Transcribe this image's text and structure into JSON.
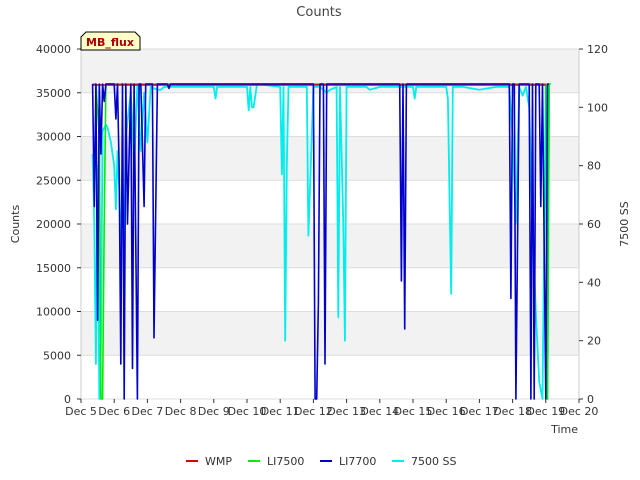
{
  "chart_data": {
    "type": "line",
    "title": "Counts",
    "xlabel": "Time",
    "ylabel": "Counts",
    "y2label": "7500 SS",
    "site_label": "MB_flux",
    "x_ticks": [
      "Dec 5",
      "Dec 6",
      "Dec 7",
      "Dec 8",
      "Dec 9",
      "Dec 10",
      "Dec 11",
      "Dec 12",
      "Dec 13",
      "Dec 14",
      "Dec 15",
      "Dec 16",
      "Dec 17",
      "Dec 18",
      "Dec 19",
      "Dec 20"
    ],
    "xlim": [
      5,
      20
    ],
    "ylim": [
      0,
      40000
    ],
    "y_ticks": [
      "0",
      "5000",
      "10000",
      "15000",
      "20000",
      "25000",
      "30000",
      "35000",
      "40000"
    ],
    "y2lim": [
      0,
      120
    ],
    "y2_ticks": [
      "0",
      "20",
      "40",
      "60",
      "80",
      "100",
      "120"
    ],
    "grid": true,
    "legend_position": "bottom",
    "legend": [
      {
        "name": "WMP",
        "color": "#dd0000"
      },
      {
        "name": "LI7500",
        "color": "#00ee00"
      },
      {
        "name": "LI7700",
        "color": "#0000cc"
      },
      {
        "name": "7500 SS",
        "color": "#00eeee"
      }
    ],
    "series": [
      {
        "name": "WMP",
        "color": "#dd0000",
        "axis": "left",
        "x": [
          5.35,
          19.0
        ],
        "y": [
          35900,
          35900
        ]
      },
      {
        "name": "LI7500",
        "color": "#00ee00",
        "axis": "left",
        "x": [
          5.35,
          5.45,
          5.55,
          5.6,
          5.65,
          5.7,
          5.75,
          5.85,
          6.0,
          19.0,
          19.05,
          19.1,
          19.15
        ],
        "y": [
          36000,
          36000,
          30000,
          0,
          0,
          20000,
          36000,
          36000,
          36000,
          36000,
          0,
          36000,
          36000
        ]
      },
      {
        "name": "LI7700",
        "color": "#0000cc",
        "axis": "left",
        "x": [
          5.35,
          5.4,
          5.45,
          5.5,
          5.55,
          5.6,
          5.65,
          5.7,
          5.75,
          5.8,
          5.9,
          6.0,
          6.05,
          6.1,
          6.15,
          6.2,
          6.25,
          6.3,
          6.35,
          6.4,
          6.5,
          6.55,
          6.6,
          6.7,
          6.75,
          6.8,
          6.9,
          6.95,
          7.0,
          7.1,
          7.15,
          7.2,
          7.3,
          7.6,
          7.65,
          7.7,
          7.75,
          9.0,
          9.05,
          12.0,
          12.05,
          12.1,
          12.15,
          12.2,
          12.3,
          12.35,
          12.4,
          12.5,
          13.0,
          13.05,
          13.1,
          14.6,
          14.65,
          14.7,
          14.75,
          14.8,
          14.85,
          14.9,
          17.9,
          17.95,
          18.0,
          18.05,
          18.1,
          18.2,
          18.3,
          18.5,
          18.55,
          18.6,
          18.65,
          18.7,
          18.8,
          18.85,
          18.9,
          19.0,
          19.05,
          19.1
        ],
        "y": [
          36000,
          22000,
          36000,
          9000,
          36000,
          28000,
          36000,
          34000,
          36000,
          36000,
          36000,
          36000,
          32000,
          36000,
          26000,
          4000,
          36000,
          0,
          36000,
          20000,
          36000,
          3500,
          36000,
          0,
          36000,
          36000,
          22000,
          36000,
          36000,
          36000,
          36000,
          7000,
          36000,
          36000,
          35500,
          36000,
          36000,
          36000,
          36000,
          36000,
          0,
          0,
          11000,
          36000,
          36000,
          4000,
          36000,
          36000,
          36000,
          36000,
          36000,
          36000,
          13500,
          36000,
          8000,
          36000,
          36000,
          36000,
          36000,
          11500,
          36000,
          36000,
          0,
          36000,
          36000,
          36000,
          0,
          36000,
          0,
          36000,
          36000,
          22000,
          36000,
          0,
          36000,
          36000
        ]
      },
      {
        "name": "7500 SS",
        "color": "#00eeee",
        "axis": "right",
        "x": [
          5.35,
          5.4,
          5.45,
          5.5,
          5.55,
          5.6,
          5.65,
          5.7,
          5.75,
          5.8,
          5.9,
          6.0,
          6.05,
          6.1,
          6.15,
          6.2,
          6.25,
          6.3,
          6.35,
          6.45,
          6.5,
          6.6,
          6.7,
          6.8,
          6.9,
          7.0,
          7.1,
          7.3,
          7.4,
          7.5,
          8.0,
          9.0,
          9.05,
          9.1,
          10.0,
          10.05,
          10.1,
          10.15,
          10.2,
          10.3,
          11.0,
          11.05,
          11.1,
          11.15,
          11.2,
          11.25,
          11.5,
          11.8,
          11.85,
          12.0,
          12.2,
          12.4,
          12.5,
          12.7,
          12.75,
          12.8,
          12.9,
          12.95,
          13.0,
          13.5,
          13.6,
          13.7,
          14.0,
          15.0,
          15.05,
          15.1,
          16.0,
          16.05,
          16.1,
          16.15,
          16.2,
          16.5,
          17.0,
          17.5,
          17.8,
          17.9,
          18.0,
          18.1,
          18.2,
          18.3,
          18.4,
          18.5,
          18.6,
          18.7,
          18.8,
          18.9,
          19.0,
          19.05,
          19.1
        ],
        "y": [
          84,
          60,
          12,
          80,
          0,
          20,
          92,
          93,
          94,
          93,
          88,
          80,
          65,
          85,
          73,
          55,
          70,
          52,
          90,
          100,
          105,
          80,
          108,
          85,
          105,
          88,
          107,
          106,
          106,
          107,
          107,
          107,
          103,
          107,
          107,
          99,
          107,
          100,
          100,
          108,
          107,
          77,
          107,
          20,
          80,
          107,
          107,
          107,
          56,
          107,
          107,
          105,
          106,
          107,
          28,
          107,
          60,
          20,
          107,
          107,
          107,
          106,
          107,
          107,
          103,
          107,
          107,
          103,
          70,
          36,
          107,
          107,
          106,
          107,
          107,
          107,
          90,
          60,
          107,
          104,
          107,
          100,
          60,
          30,
          6,
          0,
          107,
          0,
          107
        ]
      }
    ]
  }
}
